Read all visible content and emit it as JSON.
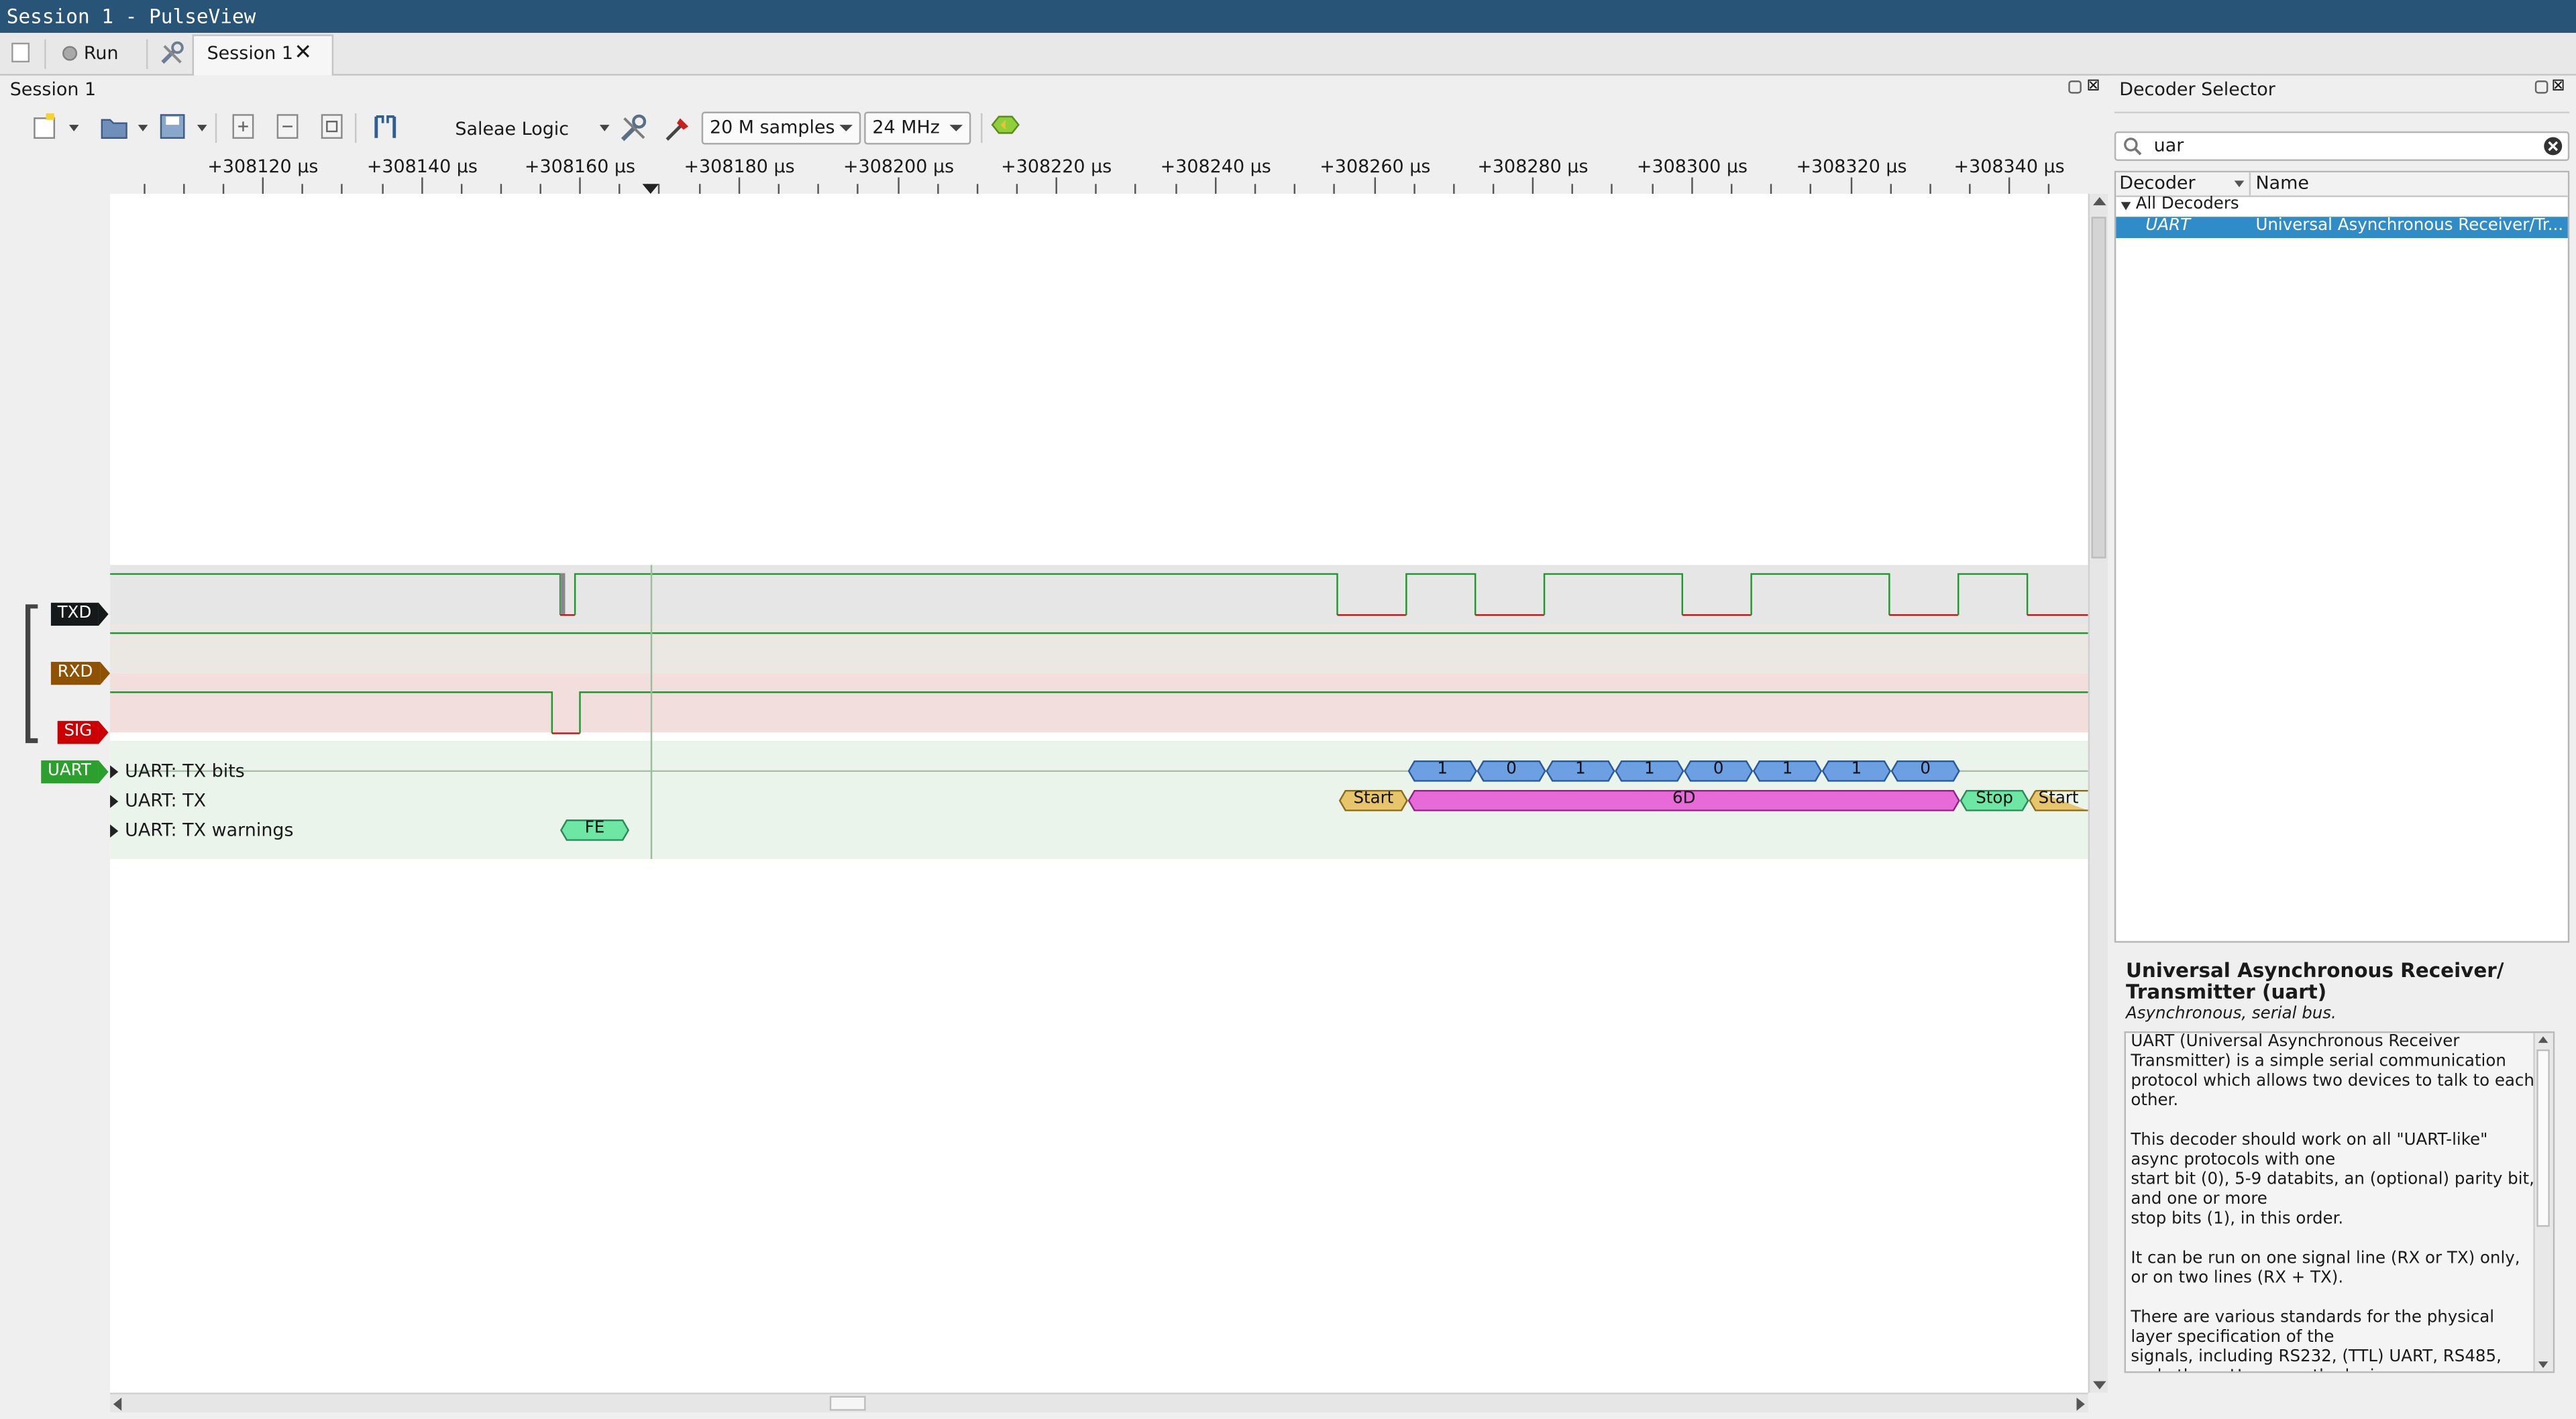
{
  "window": {
    "title": "Session 1 - PulseView"
  },
  "tabs": {
    "run_label": "Run",
    "session_label": "Session 1"
  },
  "session_panel": {
    "title": "Session 1"
  },
  "toolbar": {
    "device": "Saleae Logic",
    "samples": "20 M samples",
    "samplerate": "24 MHz"
  },
  "ruler": {
    "ticks": [
      "+308120 µs",
      "+308140 µs",
      "+308160 µs",
      "+308180 µs",
      "+308200 µs",
      "+308220 µs",
      "+308240 µs",
      "+308260 µs",
      "+308280 µs",
      "+308300 µs",
      "+308320 µs",
      "+308340 µs"
    ]
  },
  "channels": [
    {
      "name": "TXD",
      "color": "#16191a"
    },
    {
      "name": "RXD",
      "color": "#8f5202"
    },
    {
      "name": "SIG",
      "color": "#cc0000"
    }
  ],
  "decoder": {
    "name": "UART",
    "color": "#2ca02c",
    "rows": [
      {
        "label": "UART: TX bits"
      },
      {
        "label": "UART: TX"
      },
      {
        "label": "UART: TX warnings"
      }
    ],
    "bits": [
      "1",
      "0",
      "1",
      "1",
      "0",
      "1",
      "1",
      "0"
    ],
    "tx": {
      "start1": "Start",
      "data": "6D",
      "stop": "Stop",
      "start2": "Start"
    },
    "warning": "FE",
    "colors": {
      "bits": "#6d9fe3",
      "start": "#e7c66b",
      "data": "#e86ad8",
      "stop": "#6ee7a4",
      "warning": "#6ee7a4"
    }
  },
  "decoder_selector": {
    "title": "Decoder Selector",
    "search_value": "uar",
    "col_decoder": "Decoder",
    "col_name": "Name",
    "group": "All Decoders",
    "item_id": "UART",
    "item_name": "Universal Asynchronous Receiver/Tr...",
    "info_title": "Universal Asynchronous Receiver/ Transmitter (uart)",
    "info_subtitle": "Asynchronous, serial bus.",
    "description": "UART (Universal Asynchronous Receiver Transmitter) is a simple serial communication protocol which allows two devices to talk to each other.\n\nThis decoder should work on all \"UART-like\" async protocols with one\nstart bit (0), 5-9 databits, an (optional) parity bit, and one or more\nstop bits (1), in this order.\n\nIt can be run on one signal line (RX or TX) only, or on two lines (RX + TX).\n\nThere are various standards for the physical layer specification of the\nsignals, including RS232, (TTL) UART, RS485, and others. However, the logic"
  }
}
